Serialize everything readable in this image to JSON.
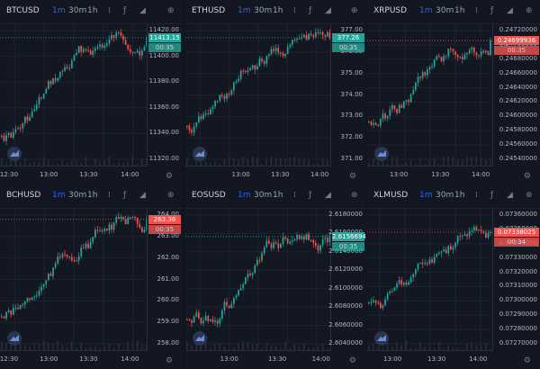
{
  "colors": {
    "up": "#26a69a",
    "down": "#ef5350",
    "background": "#131722",
    "grid": "#1e2331",
    "accent": "#2962ff"
  },
  "toolbar": {
    "timeframes": [
      "1m",
      "30m",
      "1h"
    ],
    "active_timeframe": "1m"
  },
  "panels": [
    {
      "symbol": "BTCUSD",
      "price_ticks": [
        "11420.00",
        "11400.00",
        "11380.00",
        "11360.00",
        "11340.00",
        "11320.00"
      ],
      "current_price": "11413.15",
      "countdown": "00:35",
      "direction": "up",
      "time_labels": [
        "12:30",
        "13:00",
        "13:30",
        "14:00"
      ]
    },
    {
      "symbol": "ETHUSD",
      "price_ticks": [
        "377.00",
        "376.00",
        "375.00",
        "374.00",
        "373.00",
        "372.00",
        "371.00"
      ],
      "current_price": "377.26",
      "countdown": "00:35",
      "direction": "up",
      "time_labels": [
        "13:00",
        "13:30",
        "14:00"
      ]
    },
    {
      "symbol": "XRPUSD",
      "price_ticks": [
        "0.24720000",
        "0.24700000",
        "0.24680000",
        "0.24660000",
        "0.24640000",
        "0.24620000",
        "0.24600000",
        "0.24580000",
        "0.24560000",
        "0.24540000"
      ],
      "current_price": "0.24699936",
      "countdown": "00:35",
      "direction": "down",
      "time_labels": [
        "13:00",
        "13:30",
        "14:00"
      ]
    },
    {
      "symbol": "BCHUSD",
      "price_ticks": [
        "264.00",
        "263.00",
        "262.00",
        "261.00",
        "260.00",
        "259.00",
        "258.00"
      ],
      "current_price": "263.36",
      "countdown": "00:35",
      "direction": "down",
      "time_labels": [
        "12:30",
        "13:00",
        "13:30",
        "14:00"
      ]
    },
    {
      "symbol": "EOSUSD",
      "price_ticks": [
        "2.6180000",
        "2.6160000",
        "2.6140000",
        "2.6120000",
        "2.6100000",
        "2.6080000",
        "2.6060000",
        "2.6040000"
      ],
      "current_price": "2.6156694",
      "countdown": "00:35",
      "direction": "up",
      "time_labels": [
        "13:00",
        "13:30",
        "14:00"
      ]
    },
    {
      "symbol": "XLMUSD",
      "price_ticks": [
        "0.07360000",
        "0.07350000",
        "0.07340000",
        "0.07330000",
        "0.07320000",
        "0.07310000",
        "0.07300000",
        "0.07290000",
        "0.07280000",
        "0.07270000"
      ],
      "current_price": "0.07338025",
      "countdown": "00:34",
      "direction": "down",
      "time_labels": [
        "13:00",
        "13:30",
        "14:00"
      ]
    }
  ]
}
